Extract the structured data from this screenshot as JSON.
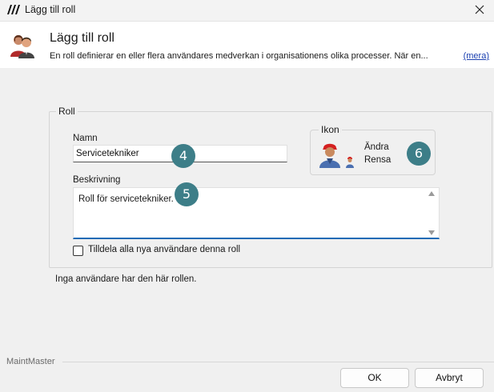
{
  "window": {
    "title": "Lägg till roll"
  },
  "header": {
    "title": "Lägg till roll",
    "description": "En roll definierar en eller flera användares medverkan i organisationens olika processer. När en...",
    "more_link": "(mera)"
  },
  "roll_group": {
    "legend": "Roll",
    "name_label": "Namn",
    "name_value": "Servicetekniker",
    "description_label": "Beskrivning",
    "description_value": "Roll för servicetekniker.",
    "assign_checkbox_label": "Tilldela alla nya användare denna roll",
    "assign_checked": false
  },
  "ikon_group": {
    "legend": "Ikon",
    "change_label": "Ändra",
    "clear_label": "Rensa"
  },
  "badges": {
    "name_step": "4",
    "description_step": "5",
    "icon_step": "6"
  },
  "info_text": "Inga användare har den här rollen.",
  "footer": {
    "brand": "MaintMaster",
    "ok_label": "OK",
    "cancel_label": "Avbryt"
  },
  "colors": {
    "badge": "#3d7e88",
    "link": "#1a3fb0",
    "focus_underline": "#1a6bb5"
  }
}
